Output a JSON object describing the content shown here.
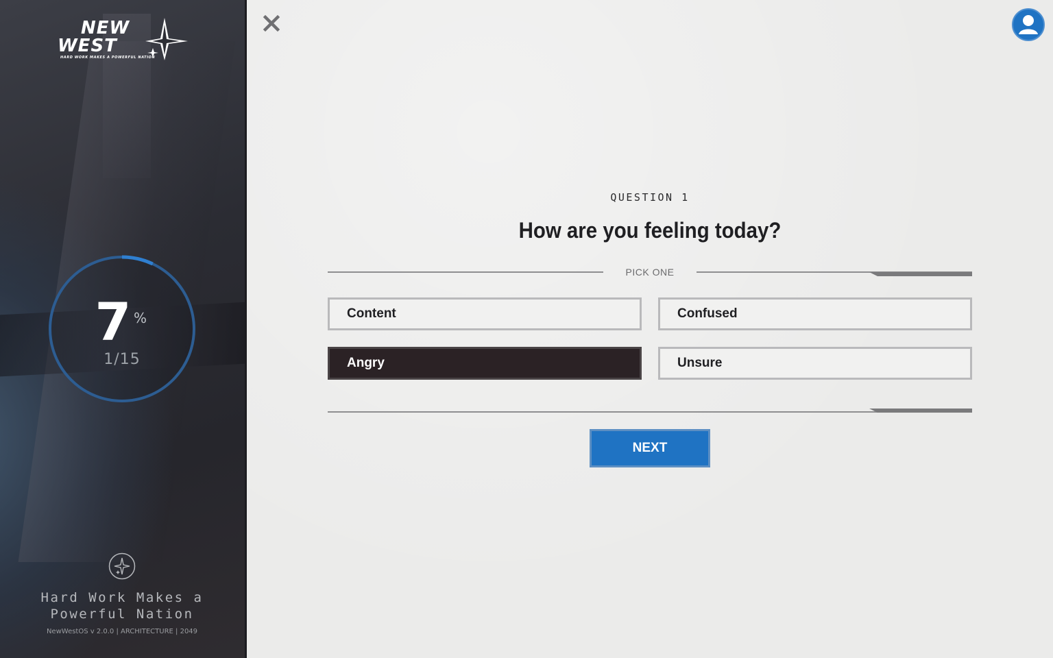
{
  "sidebar": {
    "logo_line1": "NEW",
    "logo_line2": "WEST",
    "logo_tagline": "HARD WORK MAKES A POWERFUL NATION",
    "progress": {
      "percent_value": "7",
      "percent_sign": "%",
      "percent_fraction": 0.07,
      "count": "1/15"
    },
    "motto_line1": "Hard Work Makes a",
    "motto_line2": "Powerful Nation",
    "version": "NewWestOS v 2.0.0  | ARCHITECTURE | 2049"
  },
  "header": {
    "close_icon": "close-icon",
    "avatar_icon": "user-avatar-icon"
  },
  "question": {
    "label": "QUESTION 1",
    "title": "How are you feeling today?",
    "instruction": "PICK ONE",
    "options": [
      {
        "label": "Content",
        "selected": false
      },
      {
        "label": "Confused",
        "selected": false
      },
      {
        "label": "Angry",
        "selected": true
      },
      {
        "label": "Unsure",
        "selected": false
      }
    ]
  },
  "actions": {
    "next_label": "NEXT"
  },
  "colors": {
    "accent": "#1f73c3",
    "selected_option": "#2b2225",
    "background": "#ebebea"
  }
}
